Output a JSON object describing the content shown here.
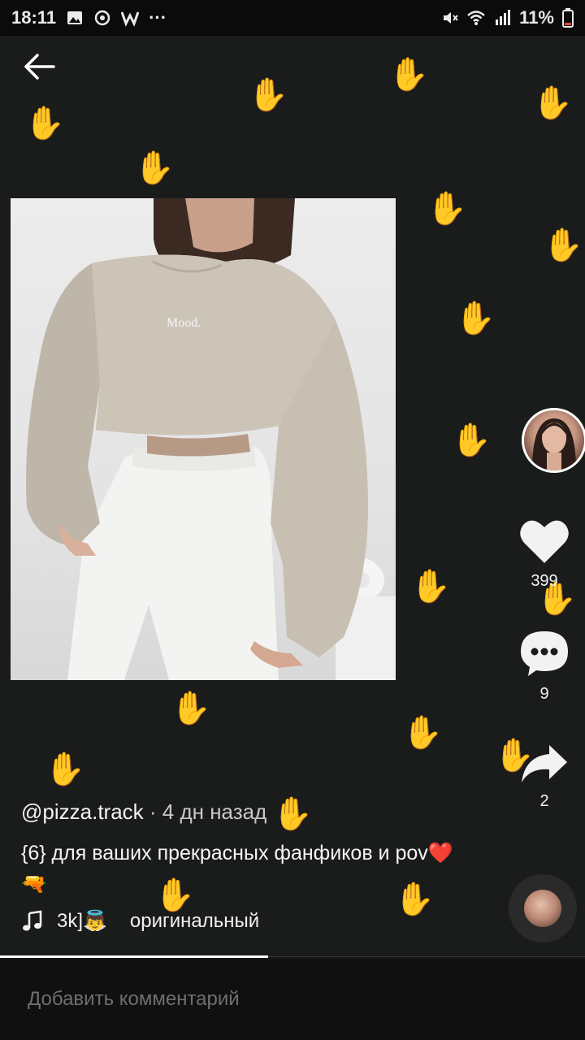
{
  "status_bar": {
    "time": "18:11",
    "battery": "11%",
    "more": "···",
    "icons": [
      "gallery-icon",
      "sync-icon",
      "w-app-icon",
      "mute-icon",
      "wifi-icon",
      "signal-icon",
      "battery-icon"
    ]
  },
  "post": {
    "author": "@pizza.track",
    "separator": " · ",
    "time_ago": "4 дн назад",
    "description": "{6} для ваших прекрасных фанфиков и pov❤️🔫",
    "photo_text": "Mood."
  },
  "actions": {
    "likes": "399",
    "comments": "9",
    "shares": "2"
  },
  "music": {
    "title": "3k]👼",
    "sound_label": "оригинальный"
  },
  "comment": {
    "placeholder": "Добавить комментарий"
  },
  "colors": {
    "background": "#1a1c1c",
    "pattern": "#3b3f3f",
    "comment_bar": "#101010"
  },
  "progress": 0.46
}
